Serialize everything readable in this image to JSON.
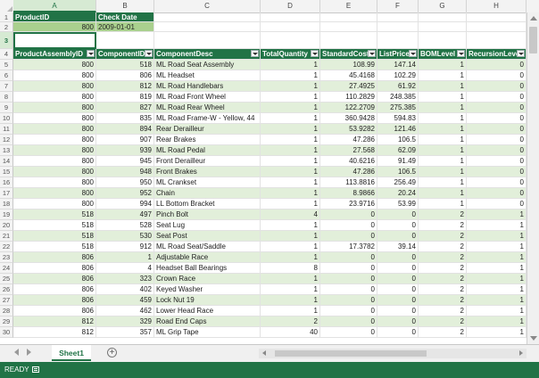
{
  "columns": [
    "A",
    "B",
    "C",
    "D",
    "E",
    "F",
    "G",
    "H"
  ],
  "param_header": {
    "product_id": "ProductID",
    "check_date": "Check Date"
  },
  "param_values": {
    "product_id": "800",
    "check_date": "2009-01-01"
  },
  "table_headers": [
    "ProductAssemblyID",
    "ComponentID",
    "ComponentDesc",
    "TotalQuantity",
    "StandardCost",
    "ListPrice",
    "BOMLevel",
    "RecursionLevel"
  ],
  "rows": [
    [
      "800",
      "518",
      "ML Road Seat Assembly",
      "1",
      "108.99",
      "147.14",
      "1",
      "0"
    ],
    [
      "800",
      "806",
      "ML Headset",
      "1",
      "45.4168",
      "102.29",
      "1",
      "0"
    ],
    [
      "800",
      "812",
      "ML Road Handlebars",
      "1",
      "27.4925",
      "61.92",
      "1",
      "0"
    ],
    [
      "800",
      "819",
      "ML Road Front Wheel",
      "1",
      "110.2829",
      "248.385",
      "1",
      "0"
    ],
    [
      "800",
      "827",
      "ML Road Rear Wheel",
      "1",
      "122.2709",
      "275.385",
      "1",
      "0"
    ],
    [
      "800",
      "835",
      "ML Road Frame-W - Yellow, 44",
      "1",
      "360.9428",
      "594.83",
      "1",
      "0"
    ],
    [
      "800",
      "894",
      "Rear Derailleur",
      "1",
      "53.9282",
      "121.46",
      "1",
      "0"
    ],
    [
      "800",
      "907",
      "Rear Brakes",
      "1",
      "47.286",
      "106.5",
      "1",
      "0"
    ],
    [
      "800",
      "939",
      "ML Road Pedal",
      "1",
      "27.568",
      "62.09",
      "1",
      "0"
    ],
    [
      "800",
      "945",
      "Front Derailleur",
      "1",
      "40.6216",
      "91.49",
      "1",
      "0"
    ],
    [
      "800",
      "948",
      "Front Brakes",
      "1",
      "47.286",
      "106.5",
      "1",
      "0"
    ],
    [
      "800",
      "950",
      "ML Crankset",
      "1",
      "113.8816",
      "256.49",
      "1",
      "0"
    ],
    [
      "800",
      "952",
      "Chain",
      "1",
      "8.9866",
      "20.24",
      "1",
      "0"
    ],
    [
      "800",
      "994",
      "LL Bottom Bracket",
      "1",
      "23.9716",
      "53.99",
      "1",
      "0"
    ],
    [
      "518",
      "497",
      "Pinch Bolt",
      "4",
      "0",
      "0",
      "2",
      "1"
    ],
    [
      "518",
      "528",
      "Seat Lug",
      "1",
      "0",
      "0",
      "2",
      "1"
    ],
    [
      "518",
      "530",
      "Seat Post",
      "1",
      "0",
      "0",
      "2",
      "1"
    ],
    [
      "518",
      "912",
      "ML Road Seat/Saddle",
      "1",
      "17.3782",
      "39.14",
      "2",
      "1"
    ],
    [
      "806",
      "1",
      "Adjustable Race",
      "1",
      "0",
      "0",
      "2",
      "1"
    ],
    [
      "806",
      "4",
      "Headset Ball Bearings",
      "8",
      "0",
      "0",
      "2",
      "1"
    ],
    [
      "806",
      "323",
      "Crown Race",
      "1",
      "0",
      "0",
      "2",
      "1"
    ],
    [
      "806",
      "402",
      "Keyed Washer",
      "1",
      "0",
      "0",
      "2",
      "1"
    ],
    [
      "806",
      "459",
      "Lock Nut 19",
      "1",
      "0",
      "0",
      "2",
      "1"
    ],
    [
      "806",
      "462",
      "Lower Head Race",
      "1",
      "0",
      "0",
      "2",
      "1"
    ],
    [
      "812",
      "329",
      "Road End Caps",
      "2",
      "0",
      "0",
      "2",
      "1"
    ],
    [
      "812",
      "357",
      "ML Grip Tape",
      "40",
      "0",
      "0",
      "2",
      "1"
    ]
  ],
  "sheet_tab": "Sheet1",
  "status": "READY",
  "theme": {
    "accent": "#217346",
    "band": "#e2efda",
    "param_value_bg": "#a9d08e"
  }
}
